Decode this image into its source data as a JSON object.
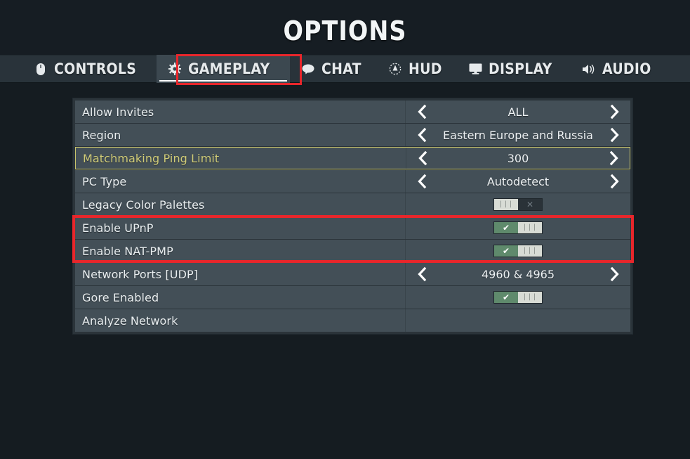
{
  "header": {
    "title": "OPTIONS"
  },
  "tabs": [
    {
      "label": "CONTROLS",
      "icon": "mouse-icon",
      "active": false
    },
    {
      "label": "GAMEPLAY",
      "icon": "gear-icon",
      "active": true
    },
    {
      "label": "CHAT",
      "icon": "speech-bubble-icon",
      "active": false
    },
    {
      "label": "HUD",
      "icon": "crosshair-icon",
      "active": false
    },
    {
      "label": "DISPLAY",
      "icon": "monitor-icon",
      "active": false
    },
    {
      "label": "AUDIO",
      "icon": "speaker-icon",
      "active": false
    }
  ],
  "options": [
    {
      "label": "Allow Invites",
      "type": "spinner",
      "value": "ALL",
      "selected": false
    },
    {
      "label": "Region",
      "type": "spinner",
      "value": "Eastern Europe and Russia",
      "selected": false
    },
    {
      "label": "Matchmaking Ping Limit",
      "type": "spinner",
      "value": "300",
      "selected": true
    },
    {
      "label": "PC Type",
      "type": "spinner",
      "value": "Autodetect",
      "selected": false
    },
    {
      "label": "Legacy Color Palettes",
      "type": "toggle",
      "value": "off",
      "selected": false
    },
    {
      "label": "Enable UPnP",
      "type": "toggle",
      "value": "on",
      "selected": false
    },
    {
      "label": "Enable NAT-PMP",
      "type": "toggle",
      "value": "on",
      "selected": false
    },
    {
      "label": "Network Ports [UDP]",
      "type": "spinner",
      "value": "4960 & 4965",
      "selected": false
    },
    {
      "label": "Gore Enabled",
      "type": "toggle",
      "value": "on",
      "selected": false
    },
    {
      "label": "Analyze Network",
      "type": "none",
      "value": "",
      "selected": false
    }
  ],
  "glyphs": {
    "check": "✔",
    "bars": "|||",
    "cross": "✕",
    "chevron_left": "‹",
    "chevron_right": "›"
  },
  "colors": {
    "background": "#151c21",
    "tab_bar": "#29333a",
    "row": "#434f57",
    "panel": "#2b343a",
    "selected_yellow": "#cfcb78",
    "toggle_on_green": "#5f8a6c",
    "annotation_red": "#e8262b"
  }
}
